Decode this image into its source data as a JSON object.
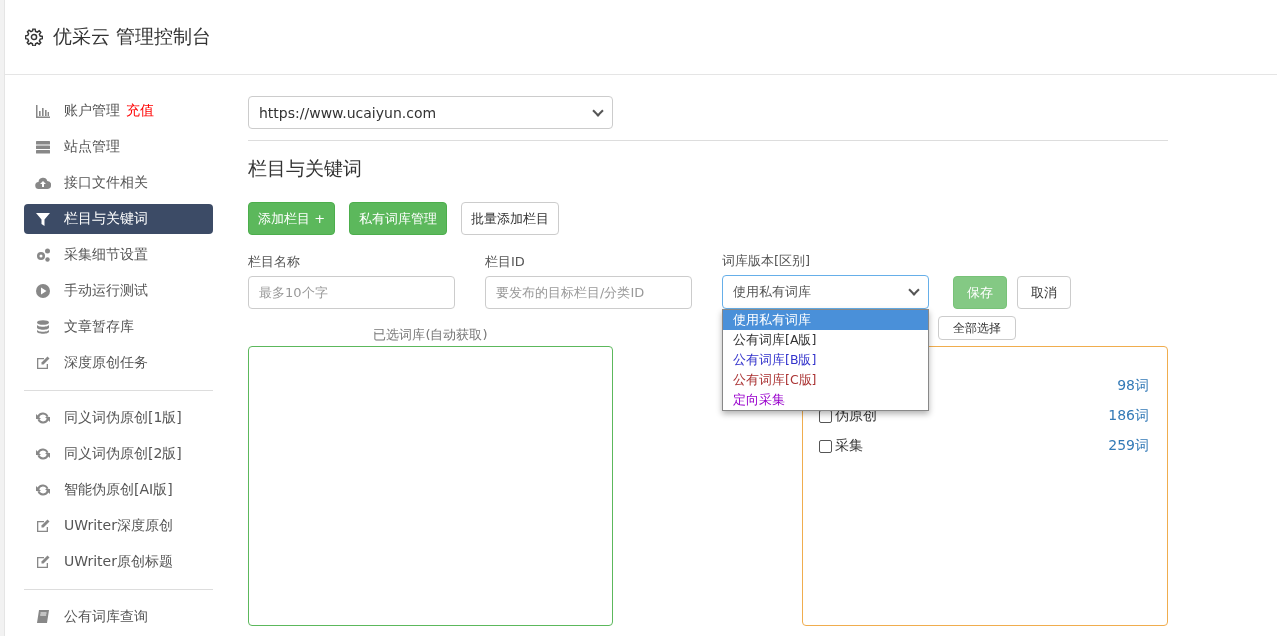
{
  "header": {
    "title": "优采云 管理控制台"
  },
  "sidebar": {
    "items": [
      {
        "kind": "chart",
        "label": "账户管理",
        "badge": "充值",
        "selected": false
      },
      {
        "kind": "server",
        "label": "站点管理",
        "selected": false
      },
      {
        "kind": "upload",
        "label": "接口文件相关",
        "selected": false
      },
      {
        "kind": "filter",
        "label": "栏目与关键词",
        "selected": true
      },
      {
        "kind": "gears",
        "label": "采集细节设置",
        "selected": false
      },
      {
        "kind": "play",
        "label": "手动运行测试",
        "selected": false
      },
      {
        "kind": "database",
        "label": "文章暂存库",
        "selected": false
      },
      {
        "kind": "edit",
        "label": "深度原创任务",
        "selected": false
      },
      {
        "kind": "divider"
      },
      {
        "kind": "refresh",
        "label": "同义词伪原创[1版]",
        "selected": false
      },
      {
        "kind": "refresh",
        "label": "同义词伪原创[2版]",
        "selected": false
      },
      {
        "kind": "refresh",
        "label": "智能伪原创[AI版]",
        "selected": false
      },
      {
        "kind": "edit",
        "label": "UWriter深度原创",
        "selected": false
      },
      {
        "kind": "edit",
        "label": "UWriter原创标题",
        "selected": false
      },
      {
        "kind": "divider"
      },
      {
        "kind": "book",
        "label": "公有词库查询",
        "selected": false
      }
    ]
  },
  "site_select": {
    "value": "https://www.ucaiyun.com"
  },
  "section_title": "栏目与关键词",
  "toolbar": [
    {
      "kind": "primary",
      "label": "添加栏目 +"
    },
    {
      "kind": "primary",
      "label": "私有词库管理"
    },
    {
      "kind": "default",
      "label": "批量添加栏目"
    }
  ],
  "form": {
    "name_label": "栏目名称",
    "name_placeholder": "最多10个字",
    "id_label": "栏目ID",
    "id_placeholder": "要发布的目标栏目/分类ID",
    "version_label": "词库版本[区别]",
    "version_value": "使用私有词库",
    "save": "保存",
    "cancel": "取消",
    "options": [
      {
        "label": "使用私有词库",
        "selected": true
      },
      {
        "label": "公有词库[A版]",
        "selected": false,
        "color": "#333333"
      },
      {
        "label": "公有词库[B版]",
        "selected": false,
        "color": "#3333cc"
      },
      {
        "label": "公有词库[C版]",
        "selected": false,
        "color": "#aa3333"
      },
      {
        "label": "定向采集",
        "selected": false,
        "color": "#9900cc"
      }
    ]
  },
  "chosen_label": "已选词库(自动获取)",
  "select_all": "全部选择",
  "library": [
    {
      "count": "98词"
    },
    {
      "name": "伪原创",
      "checked": false,
      "count": "186词"
    },
    {
      "name": "采集",
      "checked": false,
      "count": "259词"
    }
  ]
}
